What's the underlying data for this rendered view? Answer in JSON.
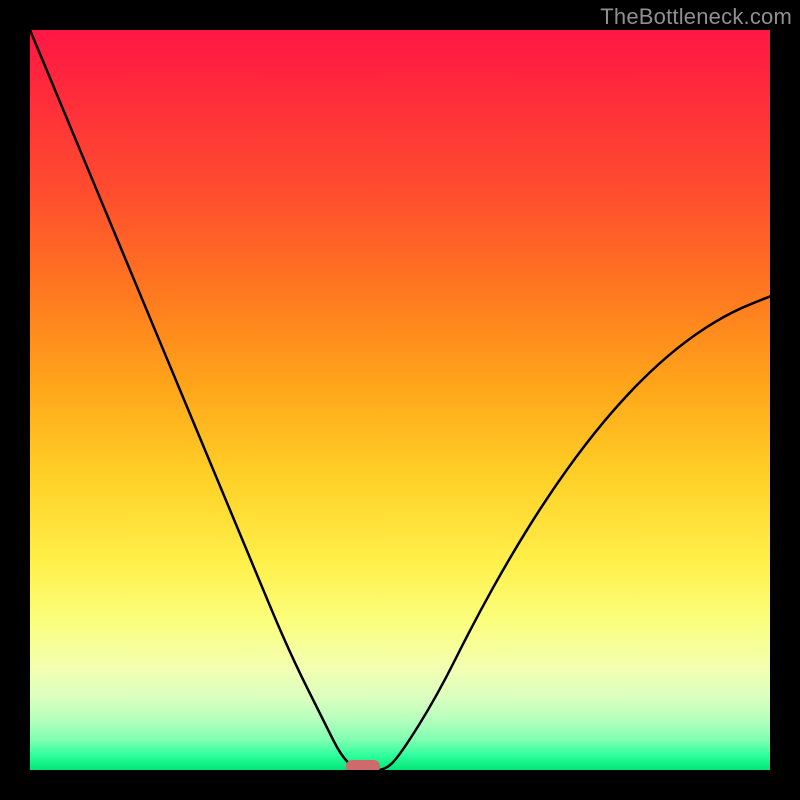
{
  "attribution": "TheBottleneck.com",
  "colors": {
    "frame": "#000000",
    "gradient_top": "#ff1744",
    "gradient_mid1": "#ffa51a",
    "gradient_mid2": "#fff04a",
    "gradient_bottom": "#00e676",
    "curve": "#000000",
    "marker": "#cf6a6a"
  },
  "chart_data": {
    "type": "line",
    "title": "",
    "xlabel": "",
    "ylabel": "",
    "xlim": [
      0,
      100
    ],
    "ylim": [
      0,
      100
    ],
    "grid": false,
    "legend": false,
    "x": [
      0,
      5,
      10,
      15,
      20,
      25,
      30,
      35,
      40,
      42,
      44,
      46,
      48,
      50,
      55,
      60,
      65,
      70,
      75,
      80,
      85,
      90,
      95,
      100
    ],
    "values": [
      100,
      88,
      76,
      64,
      52,
      40,
      28,
      16,
      6,
      2,
      0,
      0,
      0,
      2,
      10,
      20,
      29,
      37,
      44,
      50,
      55,
      59,
      62,
      64
    ],
    "annotations": [
      {
        "type": "marker",
        "x": 45,
        "y": 0,
        "shape": "rounded-rect",
        "color": "#cf6a6a"
      }
    ]
  }
}
